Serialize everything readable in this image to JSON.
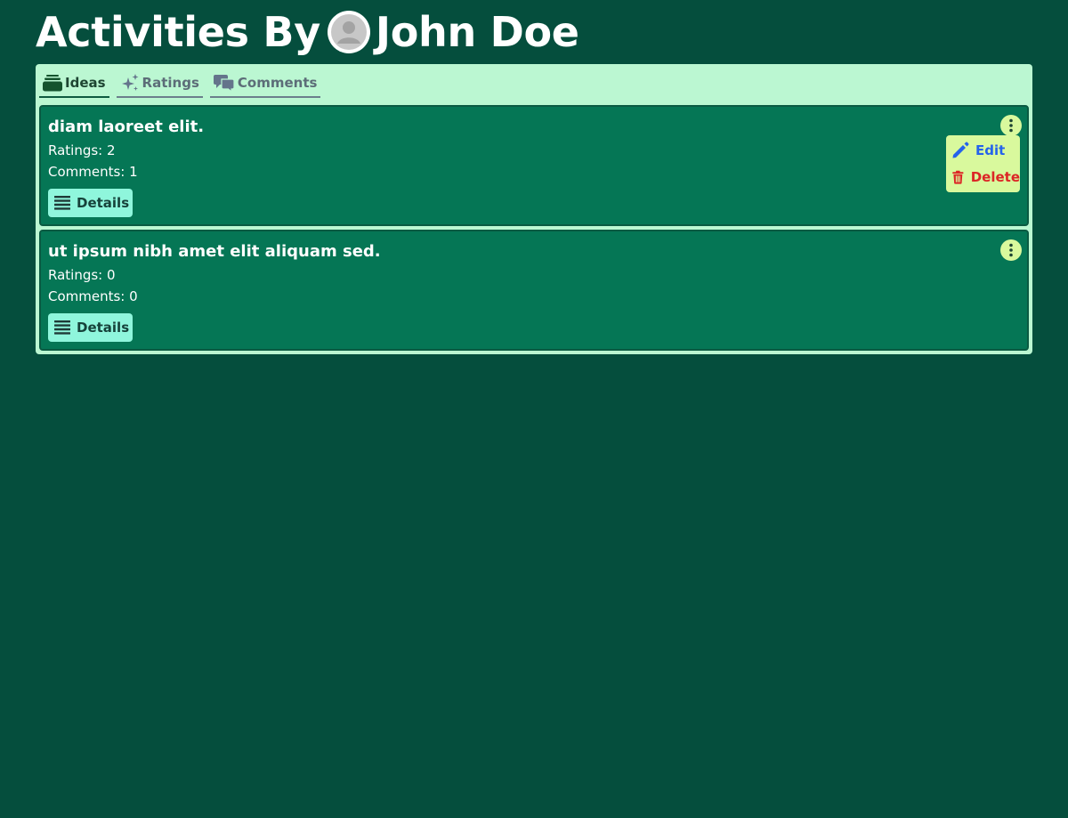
{
  "header": {
    "title_prefix": "Activities By",
    "user_name": "John Doe"
  },
  "tabs": [
    {
      "label": "Ideas",
      "icon": "stack-icon",
      "active": true
    },
    {
      "label": "Ratings",
      "icon": "sparkles-icon",
      "active": false
    },
    {
      "label": "Comments",
      "icon": "chat-bubbles-icon",
      "active": false
    }
  ],
  "ideas": [
    {
      "title": "diam laoreet elit.",
      "ratings": "Ratings: 2",
      "comments": "Comments: 1",
      "details_label": "Details",
      "menu_open": true
    },
    {
      "title": "ut ipsum nibh amet elit aliquam sed.",
      "ratings": "Ratings: 0",
      "comments": "Comments: 0",
      "details_label": "Details",
      "menu_open": false
    }
  ],
  "menu": {
    "edit_label": "Edit",
    "delete_label": "Delete"
  },
  "colors": {
    "background": "#054e3d",
    "panel": "#bbf7d2",
    "card": "#057655",
    "details_button": "#8ff6dc",
    "menu": "#d9f99d",
    "edit": "#2563eb",
    "delete": "#dc2626"
  }
}
